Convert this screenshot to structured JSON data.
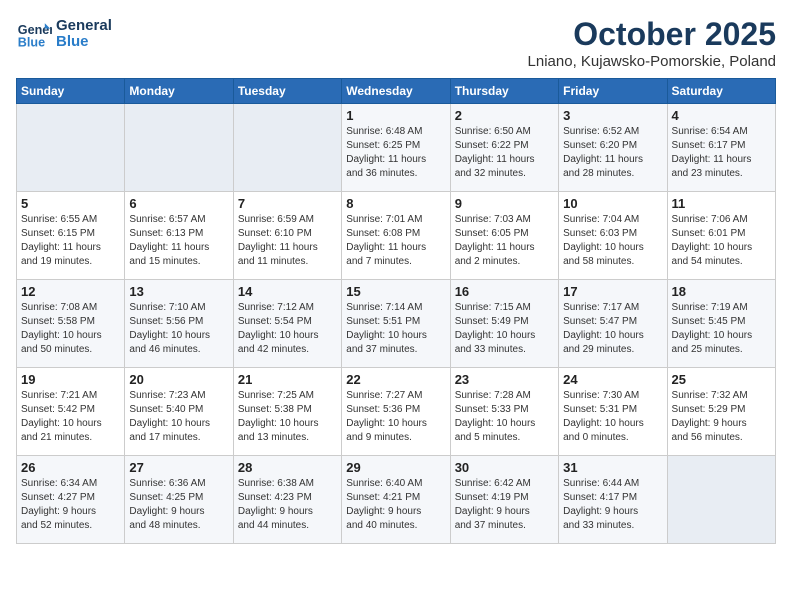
{
  "logo": {
    "line1": "General",
    "line2": "Blue"
  },
  "title": "October 2025",
  "location": "Lniano, Kujawsko-Pomorskie, Poland",
  "days_of_week": [
    "Sunday",
    "Monday",
    "Tuesday",
    "Wednesday",
    "Thursday",
    "Friday",
    "Saturday"
  ],
  "weeks": [
    [
      {
        "day": "",
        "info": ""
      },
      {
        "day": "",
        "info": ""
      },
      {
        "day": "",
        "info": ""
      },
      {
        "day": "1",
        "info": "Sunrise: 6:48 AM\nSunset: 6:25 PM\nDaylight: 11 hours\nand 36 minutes."
      },
      {
        "day": "2",
        "info": "Sunrise: 6:50 AM\nSunset: 6:22 PM\nDaylight: 11 hours\nand 32 minutes."
      },
      {
        "day": "3",
        "info": "Sunrise: 6:52 AM\nSunset: 6:20 PM\nDaylight: 11 hours\nand 28 minutes."
      },
      {
        "day": "4",
        "info": "Sunrise: 6:54 AM\nSunset: 6:17 PM\nDaylight: 11 hours\nand 23 minutes."
      }
    ],
    [
      {
        "day": "5",
        "info": "Sunrise: 6:55 AM\nSunset: 6:15 PM\nDaylight: 11 hours\nand 19 minutes."
      },
      {
        "day": "6",
        "info": "Sunrise: 6:57 AM\nSunset: 6:13 PM\nDaylight: 11 hours\nand 15 minutes."
      },
      {
        "day": "7",
        "info": "Sunrise: 6:59 AM\nSunset: 6:10 PM\nDaylight: 11 hours\nand 11 minutes."
      },
      {
        "day": "8",
        "info": "Sunrise: 7:01 AM\nSunset: 6:08 PM\nDaylight: 11 hours\nand 7 minutes."
      },
      {
        "day": "9",
        "info": "Sunrise: 7:03 AM\nSunset: 6:05 PM\nDaylight: 11 hours\nand 2 minutes."
      },
      {
        "day": "10",
        "info": "Sunrise: 7:04 AM\nSunset: 6:03 PM\nDaylight: 10 hours\nand 58 minutes."
      },
      {
        "day": "11",
        "info": "Sunrise: 7:06 AM\nSunset: 6:01 PM\nDaylight: 10 hours\nand 54 minutes."
      }
    ],
    [
      {
        "day": "12",
        "info": "Sunrise: 7:08 AM\nSunset: 5:58 PM\nDaylight: 10 hours\nand 50 minutes."
      },
      {
        "day": "13",
        "info": "Sunrise: 7:10 AM\nSunset: 5:56 PM\nDaylight: 10 hours\nand 46 minutes."
      },
      {
        "day": "14",
        "info": "Sunrise: 7:12 AM\nSunset: 5:54 PM\nDaylight: 10 hours\nand 42 minutes."
      },
      {
        "day": "15",
        "info": "Sunrise: 7:14 AM\nSunset: 5:51 PM\nDaylight: 10 hours\nand 37 minutes."
      },
      {
        "day": "16",
        "info": "Sunrise: 7:15 AM\nSunset: 5:49 PM\nDaylight: 10 hours\nand 33 minutes."
      },
      {
        "day": "17",
        "info": "Sunrise: 7:17 AM\nSunset: 5:47 PM\nDaylight: 10 hours\nand 29 minutes."
      },
      {
        "day": "18",
        "info": "Sunrise: 7:19 AM\nSunset: 5:45 PM\nDaylight: 10 hours\nand 25 minutes."
      }
    ],
    [
      {
        "day": "19",
        "info": "Sunrise: 7:21 AM\nSunset: 5:42 PM\nDaylight: 10 hours\nand 21 minutes."
      },
      {
        "day": "20",
        "info": "Sunrise: 7:23 AM\nSunset: 5:40 PM\nDaylight: 10 hours\nand 17 minutes."
      },
      {
        "day": "21",
        "info": "Sunrise: 7:25 AM\nSunset: 5:38 PM\nDaylight: 10 hours\nand 13 minutes."
      },
      {
        "day": "22",
        "info": "Sunrise: 7:27 AM\nSunset: 5:36 PM\nDaylight: 10 hours\nand 9 minutes."
      },
      {
        "day": "23",
        "info": "Sunrise: 7:28 AM\nSunset: 5:33 PM\nDaylight: 10 hours\nand 5 minutes."
      },
      {
        "day": "24",
        "info": "Sunrise: 7:30 AM\nSunset: 5:31 PM\nDaylight: 10 hours\nand 0 minutes."
      },
      {
        "day": "25",
        "info": "Sunrise: 7:32 AM\nSunset: 5:29 PM\nDaylight: 9 hours\nand 56 minutes."
      }
    ],
    [
      {
        "day": "26",
        "info": "Sunrise: 6:34 AM\nSunset: 4:27 PM\nDaylight: 9 hours\nand 52 minutes."
      },
      {
        "day": "27",
        "info": "Sunrise: 6:36 AM\nSunset: 4:25 PM\nDaylight: 9 hours\nand 48 minutes."
      },
      {
        "day": "28",
        "info": "Sunrise: 6:38 AM\nSunset: 4:23 PM\nDaylight: 9 hours\nand 44 minutes."
      },
      {
        "day": "29",
        "info": "Sunrise: 6:40 AM\nSunset: 4:21 PM\nDaylight: 9 hours\nand 40 minutes."
      },
      {
        "day": "30",
        "info": "Sunrise: 6:42 AM\nSunset: 4:19 PM\nDaylight: 9 hours\nand 37 minutes."
      },
      {
        "day": "31",
        "info": "Sunrise: 6:44 AM\nSunset: 4:17 PM\nDaylight: 9 hours\nand 33 minutes."
      },
      {
        "day": "",
        "info": ""
      }
    ]
  ]
}
